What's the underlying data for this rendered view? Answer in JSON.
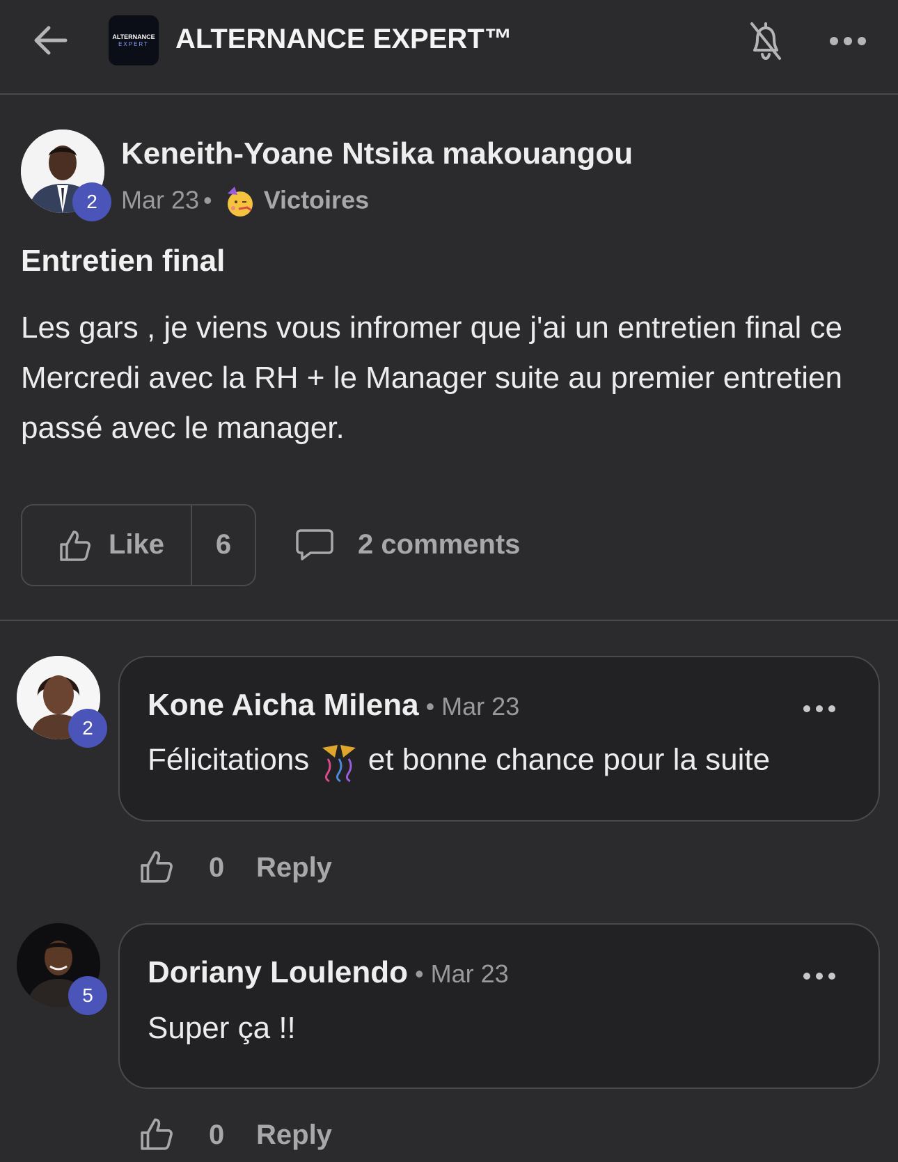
{
  "header": {
    "logo_line1": "ALTERNANCE",
    "logo_line2": "EXPERT",
    "title": "ALTERNANCE EXPERT™"
  },
  "post": {
    "author": "Keneith-Yoane Ntsika makouangou",
    "level": "2",
    "date": "Mar 23",
    "separator": "•",
    "category": "Victoires",
    "title": "Entretien final",
    "body": "Les gars , je viens vous infromer que j'ai un entretien final ce Mercredi avec la RH + le Manager suite au premier entretien passé avec le manager.",
    "like_label": "Like",
    "like_count": "6",
    "comments_label": "2 comments"
  },
  "comments": [
    {
      "author": "Kone Aicha Milena",
      "date": "• Mar 23",
      "level": "2",
      "text_before": "Félicitations",
      "text_after": "et bonne chance pour la suite",
      "likes": "0",
      "reply_label": "Reply"
    },
    {
      "author": "Doriany Loulendo",
      "date": "• Mar 23",
      "level": "5",
      "text": "Super ça !!",
      "likes": "0",
      "reply_label": "Reply"
    }
  ],
  "colors": {
    "background": "#2b2b2d",
    "bubble": "#222224",
    "level_badge": "#4b54b8",
    "muted_text": "#9a9a9c"
  }
}
